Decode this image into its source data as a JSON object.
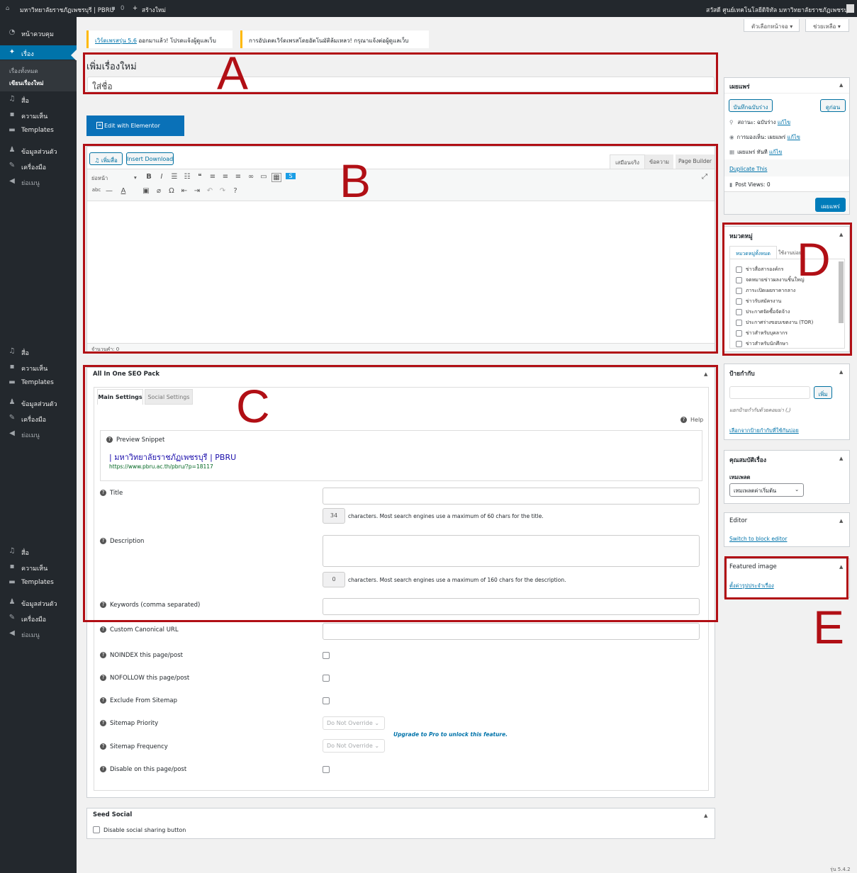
{
  "admin_bar": {
    "site_name": "มหาวิทยาลัยราชภัฏเพชรบุรี | PBRU",
    "comments_count": "0",
    "new_label": "สร้างใหม่",
    "greeting": "สวัสดี ศูนย์เทคโนโลยีดิจิทัล มหาวิทยาลัยราชภัฏเพชรบุรี"
  },
  "sidebar": {
    "dashboard": "หน้าควบคุม",
    "posts": "เรื่อง",
    "all_posts": "เรื่องทั้งหมด",
    "add_new": "เขียนเรื่องใหม่",
    "media": "สื่อ",
    "comments": "ความเห็น",
    "templates": "Templates",
    "profile": "ข้อมูลส่วนตัว",
    "tools": "เครื่องมือ",
    "collapse": "ย่อเมนู"
  },
  "screen_options": "ตัวเลือกหน้าจอ",
  "help": "ช่วยเหลือ",
  "notices": {
    "update_link": "เวิร์ดเพรสรุ่น 5.6",
    "update_text": "ออกมาแล้ว! โปรดแจ้งผู้ดูแลเว็บ",
    "auto_update_fail": "การอัปเดตเวิร์ดเพรสโดยอัตโนมัติล้มเหลว! กรุณาแจ้งต่อผู้ดูแลเว็บ"
  },
  "editor": {
    "page_title": "เพิ่มเรื่องใหม่",
    "title_placeholder": "ใส่ชื่อ",
    "elementor_button": "Edit with Elementor",
    "add_media": "เพิ่มสื่อ",
    "insert_download": "Insert Download",
    "tab_visual": "เสมือนจริง",
    "tab_text": "ข้อความ",
    "tab_builder": "Page Builder",
    "format_select": "ย่อหน้า",
    "word_count": "จำนวนคำ: 0"
  },
  "seo": {
    "box_title": "All In One SEO Pack",
    "tab_main": "Main Settings",
    "tab_social": "Social Settings",
    "help": "Help",
    "preview_label": "Preview Snippet",
    "preview_title": "| มหาวิทยาลัยราชภัฏเพชรบุรี | PBRU",
    "preview_url": "https://www.pbru.ac.th/pbru/?p=18117",
    "title_label": "Title",
    "title_count": "34",
    "title_hint": "characters. Most search engines use a maximum of 60 chars for the title.",
    "desc_label": "Description",
    "desc_count": "0",
    "desc_hint": "characters. Most search engines use a maximum of 160 chars for the description.",
    "keywords_label": "Keywords (comma separated)",
    "canonical_label": "Custom Canonical URL",
    "noindex_label": "NOINDEX this page/post",
    "nofollow_label": "NOFOLLOW this page/post",
    "exclude_label": "Exclude From Sitemap",
    "priority_label": "Sitemap Priority",
    "frequency_label": "Sitemap Frequency",
    "disable_label": "Disable on this page/post",
    "priority_value": "Do Not Override",
    "frequency_value": "Do Not Override",
    "upgrade_text": "Upgrade to Pro to unlock this feature."
  },
  "seed_social": {
    "title": "Seed Social",
    "disable_label": "Disable social sharing button"
  },
  "publish": {
    "title": "เผยแพร่",
    "save_draft": "บันทึกฉบับร่าง",
    "preview": "ดูก่อน",
    "status_label": "สถานะ: ฉบับร่าง",
    "visibility_label": "การมองเห็น: เผยแพร่",
    "publish_label": "เผยแพร่ ทันที",
    "edit": "แก้ไข",
    "duplicate": "Duplicate This",
    "post_views": "Post Views: 0",
    "publish_button": "เผยแพร่"
  },
  "categories": {
    "title": "หมวดหมู่",
    "tab_all": "หมวดหมู่ทั้งหมด",
    "tab_used": "ใช้งานบ่อย",
    "items": [
      "ข่าวสื่อสารองค์กร",
      "จดหมายข่าวผลงานชิ้นใหญ่",
      "ภาระเปิดเผยราคากลาง",
      "ข่าวรับสมัครงาน",
      "ประกาศจัดซื้อจัดจ้าง",
      "ประกาศร่างขอบเขตงาน (TOR)",
      "ข่าวสำหรับบุคลากร",
      "ข่าวสำหรับนักศึกษา"
    ]
  },
  "tags": {
    "title": "ป้ายกำกับ",
    "add_button": "เพิ่ม",
    "hint": "แยกป้ายกำกับด้วยคอมม่า (,)",
    "choose": "เลือกจากป้ายกำกับที่ใช้กันบ่อย"
  },
  "attributes": {
    "title": "คุณสมบัติเรื่อง",
    "template_label": "เทมเพลต",
    "template_value": "เทมเพลตค่าเริ่มต้น"
  },
  "editor_box": {
    "title": "Editor",
    "switch": "Switch to block editor"
  },
  "featured": {
    "title": "Featured image",
    "set": "ตั้งค่ารูปประจำเรื่อง"
  },
  "version": "รุ่น 5.4.2",
  "annotations": {
    "a": "A",
    "b": "B",
    "c": "C",
    "d": "D",
    "e": "E"
  },
  "colors": {
    "admin_bar": "#23282d",
    "active": "#0073aa",
    "annotation": "#b10f15",
    "notice_accent": "#ffb900"
  }
}
